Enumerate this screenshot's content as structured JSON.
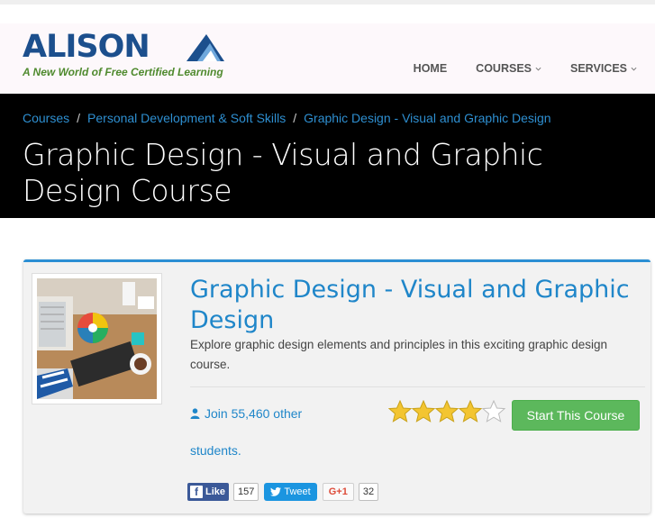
{
  "header": {
    "logo_text": "ALISON",
    "logo_tagline": "A New World of Free Certified Learning",
    "nav": [
      {
        "label": "HOME",
        "icon": ""
      },
      {
        "label": "COURSES",
        "icon": "chevron-down-icon"
      },
      {
        "label": "SERVICES",
        "icon": "chevron-down-icon"
      }
    ]
  },
  "breadcrumb": {
    "items": [
      "Courses",
      "Personal Development & Soft Skills",
      "Graphic Design - Visual and Graphic Design"
    ],
    "separator": "/"
  },
  "page_title": "Graphic Design - Visual and Graphic Design Course",
  "course": {
    "title": "Graphic Design - Visual and Graphic Design",
    "description": "Explore graphic design elements and principles in this exciting graphic design course.",
    "join_text": "Join 55,460 other",
    "join_text_2": "students.",
    "rating_stars": 4,
    "rating_max": 5,
    "start_button": "Start This Course",
    "thumbnail_icon": "course-thumbnail-image"
  },
  "social": {
    "like_label": "Like",
    "like_count": "157",
    "tweet_label": "Tweet",
    "gplus_label": "G+1",
    "gplus_count": "32"
  },
  "colors": {
    "brand_blue": "#1c4f8d",
    "link_blue": "#1f86c9",
    "tagline_green": "#4f8a2e",
    "button_green": "#5cb85c",
    "star_gold": "#f3c531",
    "banner_bg": "#000000"
  }
}
